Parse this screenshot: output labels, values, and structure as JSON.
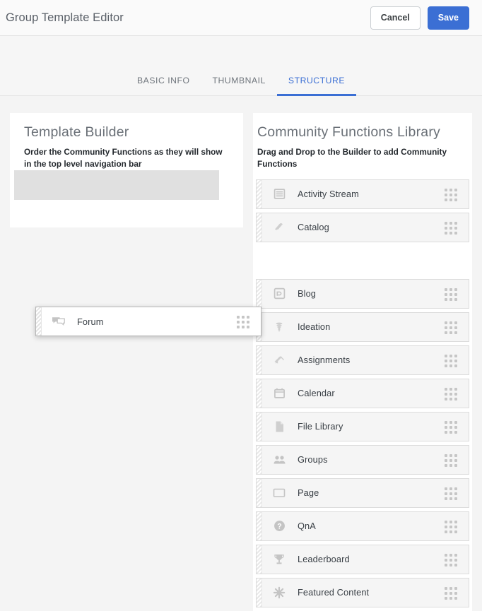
{
  "header": {
    "title": "Group Template Editor",
    "cancel_label": "Cancel",
    "save_label": "Save",
    "accent_color": "#3b6fd4"
  },
  "tabs": [
    {
      "label": "BASIC INFO",
      "active": false
    },
    {
      "label": "THUMBNAIL",
      "active": false
    },
    {
      "label": "STRUCTURE",
      "active": true
    }
  ],
  "builder": {
    "title": "Template Builder",
    "subtitle": "Order the Community Functions as they will show in the top level navigation bar",
    "items": []
  },
  "library": {
    "title": "Community Functions Library",
    "subtitle": "Drag and Drop to the Builder to add Community Functions",
    "items": [
      {
        "label": "Activity Stream",
        "icon": "activity-stream-icon"
      },
      {
        "label": "Catalog",
        "icon": "catalog-icon"
      },
      {
        "label": "Blog",
        "icon": "blog-icon"
      },
      {
        "label": "Ideation",
        "icon": "lightbulb-icon"
      },
      {
        "label": "Assignments",
        "icon": "assignments-icon"
      },
      {
        "label": "Calendar",
        "icon": "calendar-icon"
      },
      {
        "label": "File Library",
        "icon": "file-icon"
      },
      {
        "label": "Groups",
        "icon": "groups-icon"
      },
      {
        "label": "Page",
        "icon": "page-icon"
      },
      {
        "label": "QnA",
        "icon": "question-icon"
      },
      {
        "label": "Leaderboard",
        "icon": "trophy-icon"
      },
      {
        "label": "Featured Content",
        "icon": "starburst-icon"
      }
    ]
  },
  "drag": {
    "label": "Forum",
    "icon": "forum-icon"
  }
}
